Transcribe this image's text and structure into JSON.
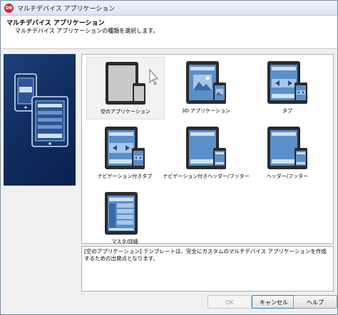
{
  "window": {
    "title": "マルチデバイス アプリケーション",
    "icon_label": "DB"
  },
  "header": {
    "title": "マルチデバイス アプリケーション",
    "description": "マルチデバイス アプリケーションの種類を選択します。"
  },
  "templates": [
    {
      "label": "空のアプリケーション",
      "icon": "blank-app-icon",
      "selected": true
    },
    {
      "label": "3D アプリケーション",
      "icon": "3d-app-icon",
      "selected": false
    },
    {
      "label": "タブ",
      "icon": "tabbed-app-icon",
      "selected": false
    },
    {
      "label": "ナビゲーション付きタブ",
      "icon": "tabbed-navigation-app-icon",
      "selected": false
    },
    {
      "label": "ナビゲーション付きヘッダー/フッター",
      "icon": "header-footer-navigation-app-icon",
      "selected": false
    },
    {
      "label": "ヘッダー/フッター",
      "icon": "header-footer-app-icon",
      "selected": false
    },
    {
      "label": "マスタ/詳細",
      "icon": "master-detail-app-icon",
      "selected": false
    }
  ],
  "description_text": "[空のアプリケーション] テンプレートは、完全にカスタムのマルチデバイス アプリケーションを作成するための出発点となります。",
  "buttons": {
    "ok": "OK",
    "cancel": "キャンセル",
    "help": "ヘルプ"
  },
  "colors": {
    "banner": "#123a72",
    "device_screen": "#5b8fc8",
    "accent": "#d8262c"
  }
}
